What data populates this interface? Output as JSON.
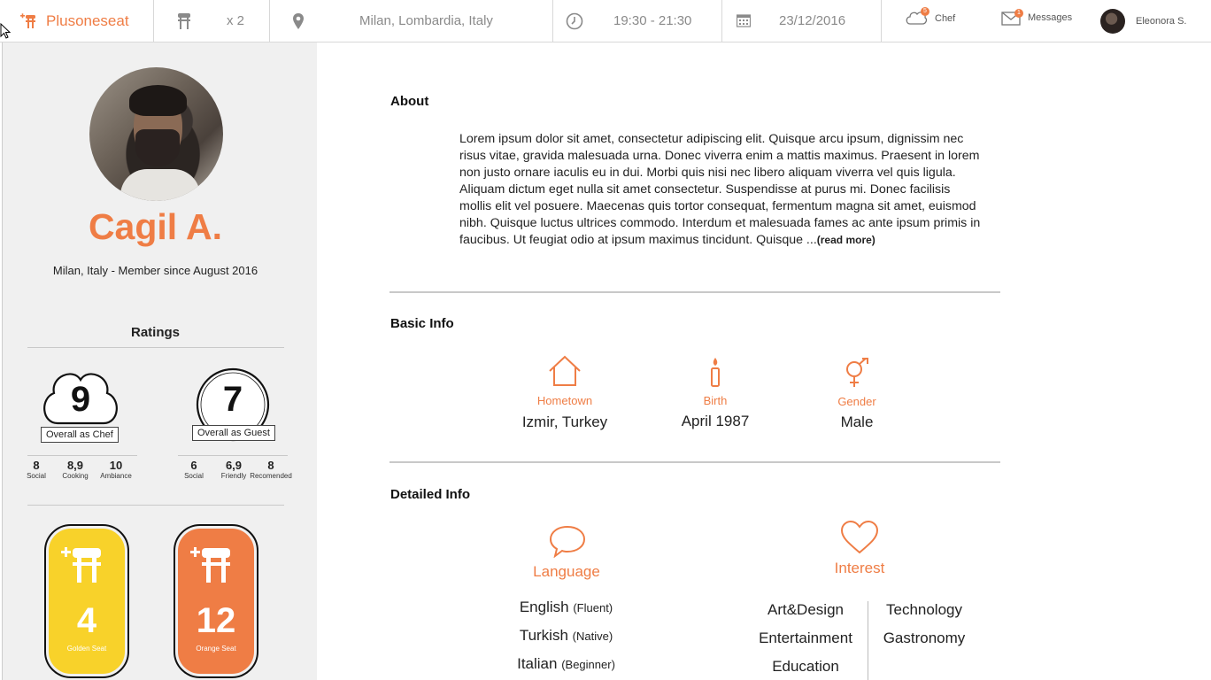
{
  "topbar": {
    "brand": "Plusoneseat",
    "guests": "x 2",
    "location": "Milan, Lombardia, Italy",
    "time": "19:30 - 21:30",
    "date": "23/12/2016",
    "chef_label": "Chef",
    "chef_badge": "5",
    "messages_label": "Messages",
    "messages_badge": "1",
    "user_name": "Eleonora S."
  },
  "profile": {
    "name": "Cagil A.",
    "member_line": "Milan, Italy - Member since August 2016"
  },
  "ratings": {
    "title": "Ratings",
    "chef": {
      "score": "9",
      "label": "Overall as Chef",
      "subs": [
        {
          "value": "8",
          "label": "Social"
        },
        {
          "value": "8,9",
          "label": "Cooking"
        },
        {
          "value": "10",
          "label": "Ambiance"
        }
      ]
    },
    "guest": {
      "score": "7",
      "label": "Overall as Guest",
      "subs": [
        {
          "value": "6",
          "label": "Social"
        },
        {
          "value": "6,9",
          "label": "Friendly"
        },
        {
          "value": "8",
          "label": "Recomended"
        }
      ]
    }
  },
  "seats": [
    {
      "count": "4",
      "label": "Golden Seat",
      "color": "#f8d22a"
    },
    {
      "count": "12",
      "label": "Orange Seat",
      "color": "#ef7d45"
    }
  ],
  "about": {
    "title": "About",
    "text": "Lorem ipsum dolor sit amet, consectetur adipiscing elit. Quisque arcu ipsum, dignissim nec risus vitae, gravida malesuada urna. Donec viverra enim a mattis maximus. Praesent in lorem non justo ornare iaculis eu in dui. Morbi quis nisi nec libero aliquam viverra vel quis ligula. Aliquam dictum eget nulla sit amet consectetur. Suspendisse at purus mi. Donec facilisis mollis elit vel posuere. Maecenas quis tortor consequat, fermentum magna sit amet, euismod nibh. Quisque luctus ultrices commodo. Interdum et malesuada fames ac ante ipsum primis in faucibus. Ut feugiat odio at ipsum maximus tincidunt. Quisque ...",
    "read_more": "(read more)"
  },
  "basic_info": {
    "title": "Basic Info",
    "hometown": {
      "label": "Hometown",
      "value": "Izmir, Turkey"
    },
    "birth": {
      "label": "Birth",
      "value": "April 1987"
    },
    "gender": {
      "label": "Gender",
      "value": "Male"
    }
  },
  "detailed_info": {
    "title": "Detailed Info",
    "language_label": "Language",
    "languages": [
      {
        "name": "English",
        "level": "(Fluent)"
      },
      {
        "name": "Turkish",
        "level": "(Native)"
      },
      {
        "name": "Italian",
        "level": "(Beginner)"
      }
    ],
    "interest_label": "Interest",
    "interests_left": [
      "Art&Design",
      "Entertainment",
      "Education"
    ],
    "interests_right": [
      "Technology",
      "Gastronomy"
    ]
  },
  "colors": {
    "accent": "#ef7d45",
    "gold": "#f8d22a"
  }
}
